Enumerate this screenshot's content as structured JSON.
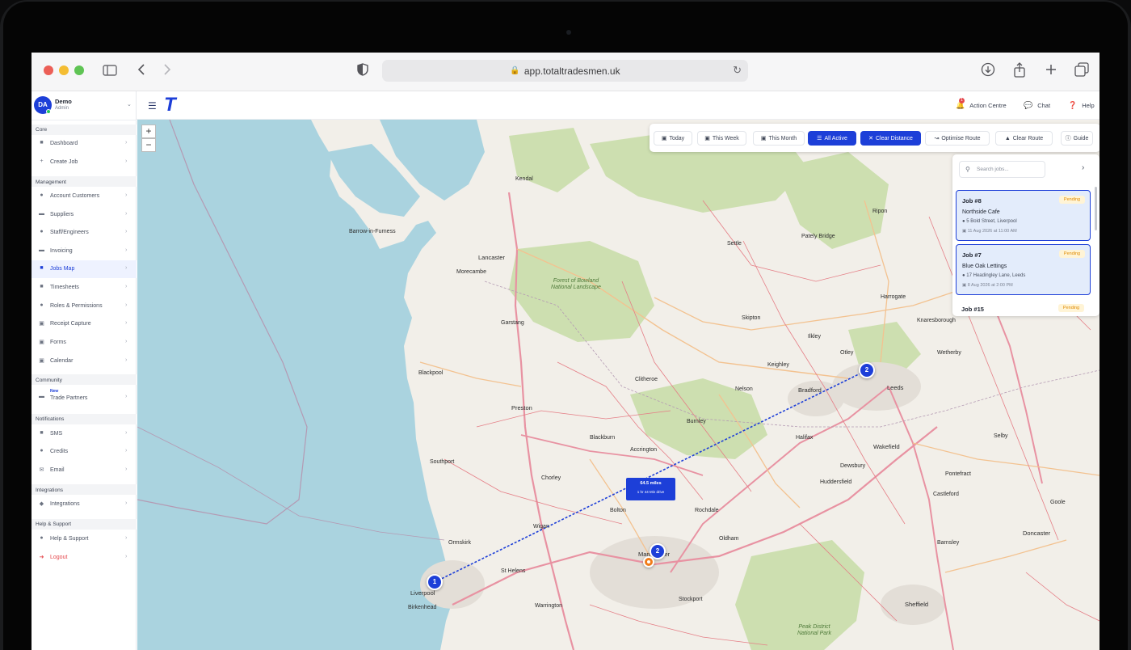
{
  "browser": {
    "url": "app.totaltradesmen.uk",
    "icons": [
      "sidebar-icon",
      "back-icon",
      "forward-icon",
      "shield-icon",
      "download-icon",
      "share-icon",
      "new-tab-icon",
      "tabs-icon"
    ]
  },
  "header": {
    "logo": "T",
    "action_centre": "Action Centre",
    "action_centre_badge": "1",
    "chat": "Chat",
    "help": "Help"
  },
  "user": {
    "initials": "DA",
    "name": "Demo",
    "role": "Admin"
  },
  "sidebar": {
    "sections": [
      {
        "title": "Core"
      },
      {
        "title": "Management"
      },
      {
        "title": "Community"
      },
      {
        "title": "Notifications"
      },
      {
        "title": "Integrations"
      },
      {
        "title": "Help & Support"
      }
    ],
    "items": [
      {
        "label": "Dashboard",
        "icon": "dashboard-icon"
      },
      {
        "label": "Create Job",
        "icon": "plus-icon"
      },
      {
        "label": "Account Customers",
        "icon": "user-icon"
      },
      {
        "label": "Suppliers",
        "icon": "truck-icon"
      },
      {
        "label": "Staff/Engineers",
        "icon": "users-icon"
      },
      {
        "label": "Invoicing",
        "icon": "card-icon"
      },
      {
        "label": "Jobs Map",
        "icon": "map-icon"
      },
      {
        "label": "Timesheets",
        "icon": "clock-icon"
      },
      {
        "label": "Roles & Permissions",
        "icon": "roles-icon"
      },
      {
        "label": "Receipt Capture",
        "icon": "receipt-icon"
      },
      {
        "label": "Forms",
        "icon": "form-icon"
      },
      {
        "label": "Calendar",
        "icon": "calendar-icon"
      },
      {
        "label": "Trade Partners",
        "badge": "New",
        "icon": "handshake-icon"
      },
      {
        "label": "SMS",
        "icon": "sms-icon"
      },
      {
        "label": "Credits",
        "icon": "credits-icon"
      },
      {
        "label": "Email",
        "icon": "email-icon"
      },
      {
        "label": "Integrations",
        "icon": "plug-icon"
      },
      {
        "label": "Help & Support",
        "icon": "help-icon"
      },
      {
        "label": "Logout",
        "icon": "logout-icon"
      }
    ]
  },
  "toolbar": {
    "buttons": [
      "Today",
      "This Week",
      "This Month",
      "All Active",
      "Clear Distance",
      "Optimise Route",
      "Clear Route",
      "Guide"
    ]
  },
  "map": {
    "zoom_in": "+",
    "zoom_out": "−",
    "distance": "64.5 miles",
    "drive_time": "1 hr 44 Min drive",
    "markers": [
      "1",
      "2",
      "2"
    ],
    "towns": [
      "Lancaster",
      "Preston",
      "Blackpool",
      "Liverpool",
      "Manchester",
      "Leeds",
      "Bradford",
      "Wakefield",
      "Sheffield",
      "Doncaster",
      "Ripon",
      "Harrogate",
      "Skipton",
      "Blackburn",
      "Burnley",
      "Bolton",
      "Wigan",
      "Southport",
      "Halifax",
      "Huddersfield",
      "Kendal",
      "Settle",
      "Chorley",
      "Stockport",
      "Barnsley",
      "Rochdale",
      "Oldham",
      "Birkenhead",
      "Warrington",
      "Ilkley",
      "Otley",
      "Keighley",
      "Selby",
      "Pontefract",
      "Clitheroe",
      "Morecambe",
      "Barrow-in-Furness",
      "Pately Bridge",
      "Garstang",
      "Ormskirk",
      "St Helens",
      "Accrington",
      "Nelson",
      "Dewsbury",
      "Castleford",
      "Goole",
      "Wetherby",
      "Knaresborough"
    ],
    "parks": [
      "Forest of Bowland National Landscape",
      "Peak District National Park"
    ]
  },
  "jobs": {
    "search_placeholder": "Search jobs...",
    "list": [
      {
        "title": "Job #8",
        "status": "Pending",
        "name": "Northside Cafe",
        "address": "5 Bold Street, Liverpool",
        "date": "11 Aug 2026 at 11:00 AM"
      },
      {
        "title": "Job #7",
        "status": "Pending",
        "name": "Blue Oak Lettings",
        "address": "17 Headingley Lane, Leeds",
        "date": "8 Aug 2026 at 2:00 PM"
      },
      {
        "title": "Job #15",
        "status": "Pending"
      }
    ]
  },
  "colors": {
    "accent": "#1d3fd8",
    "pending": "#e08a00",
    "danger": "#e5484d",
    "sea": "#aad3df",
    "green": "#cddfb0"
  }
}
